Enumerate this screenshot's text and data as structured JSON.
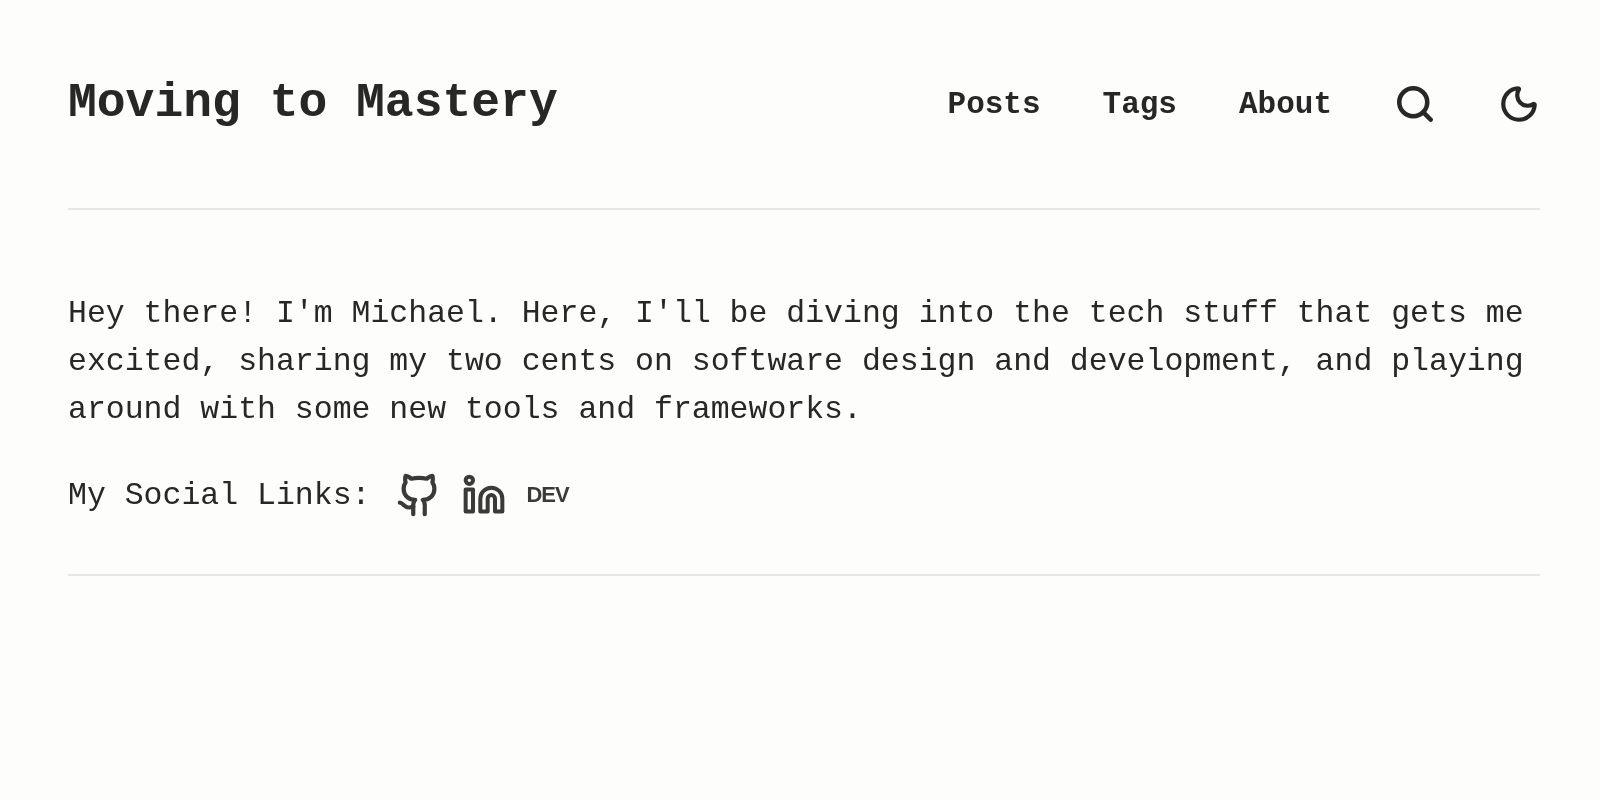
{
  "header": {
    "title": "Moving to Mastery",
    "nav": [
      "Posts",
      "Tags",
      "About"
    ]
  },
  "intro": "Hey there! I'm Michael. Here, I'll be diving into the tech stuff that gets me excited, sharing my two cents on software design and development, and playing around with some new tools and frameworks.",
  "social": {
    "label": "My Social Links:",
    "links": [
      {
        "kind": "github"
      },
      {
        "kind": "linkedin"
      },
      {
        "kind": "dev",
        "text": "DEV"
      }
    ]
  }
}
